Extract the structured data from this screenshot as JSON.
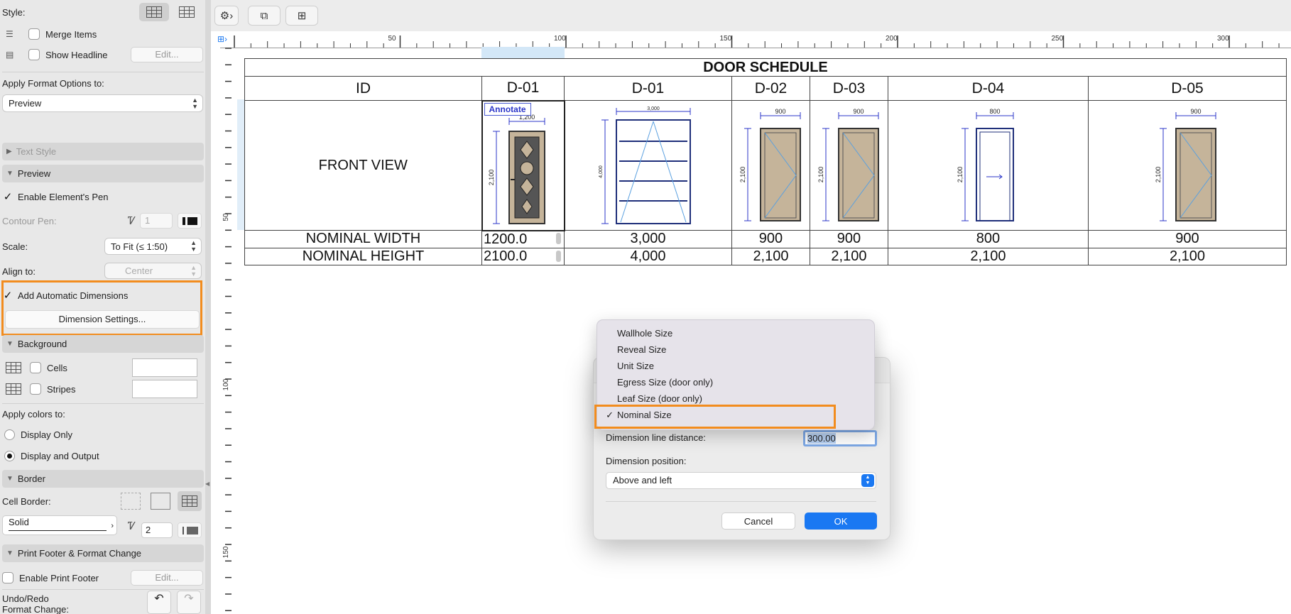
{
  "panel": {
    "style_label": "Style:",
    "merge_items": "Merge Items",
    "show_headline": "Show Headline",
    "edit_label": "Edit...",
    "apply_format_label": "Apply Format Options to:",
    "apply_format_value": "Preview",
    "text_style": "Text Style",
    "preview": "Preview",
    "enable_pen": "Enable Element's Pen",
    "contour_pen": "Contour Pen:",
    "contour_pen_value": "1",
    "scale_label": "Scale:",
    "scale_value": "To Fit (≤ 1:50)",
    "align_label": "Align to:",
    "align_value": "Center",
    "add_auto_dims": "Add Automatic Dimensions",
    "dim_settings": "Dimension Settings...",
    "background": "Background",
    "cells": "Cells",
    "stripes": "Stripes",
    "apply_colors": "Apply colors to:",
    "display_only": "Display Only",
    "display_output": "Display and Output",
    "border": "Border",
    "cell_border": "Cell Border:",
    "border_style": "Solid",
    "border_pen": "2",
    "print_footer": "Print Footer & Format Change",
    "enable_print_footer": "Enable Print Footer",
    "undo_redo": "Undo/Redo",
    "format_change": "Format Change:"
  },
  "ruler": {
    "top": [
      "50",
      "100",
      "150",
      "200",
      "250",
      "300"
    ],
    "left": [
      "50",
      "100",
      "150"
    ]
  },
  "schedule": {
    "title": "DOOR SCHEDULE",
    "id_label": "ID",
    "ids": [
      "D-01",
      "D-01",
      "D-02",
      "D-03",
      "D-04",
      "D-05"
    ],
    "front_view": "FRONT VIEW",
    "annotate": "Annotate",
    "nominal_width": "NOMINAL WIDTH",
    "nominal_height": "NOMINAL HEIGHT",
    "widths": [
      "1200.0",
      "3,000",
      "900",
      "900",
      "800",
      "900"
    ],
    "heights": [
      "2100.0",
      "4,000",
      "2,100",
      "2,100",
      "2,100",
      "2,100"
    ],
    "dim_w": [
      "1,200",
      "3,000",
      "900",
      "900",
      "800",
      "900"
    ],
    "dim_h": [
      "2,100",
      "4,000",
      "2,100",
      "2,100",
      "2,100",
      "2,100"
    ]
  },
  "menu": {
    "items": [
      "Wallhole Size",
      "Reveal Size",
      "Unit Size",
      "Egress Size (door only)",
      "Leaf Size (door only)",
      "Nominal Size"
    ],
    "selected_index": 5
  },
  "dialog": {
    "distance_label": "Dimension line distance:",
    "distance_value": "300.00",
    "position_label": "Dimension position:",
    "position_value": "Above and left",
    "cancel": "Cancel",
    "ok": "OK"
  },
  "colors": {
    "accent": "#1a78f2",
    "highlight": "#f28c1e",
    "door_fill": "#c5b49a",
    "dim_blue": "#2b36c9"
  },
  "icons": [
    "gear-icon",
    "table-layout-icon",
    "schedule-icon",
    "grid-style-icon",
    "undo-icon",
    "redo-icon"
  ]
}
